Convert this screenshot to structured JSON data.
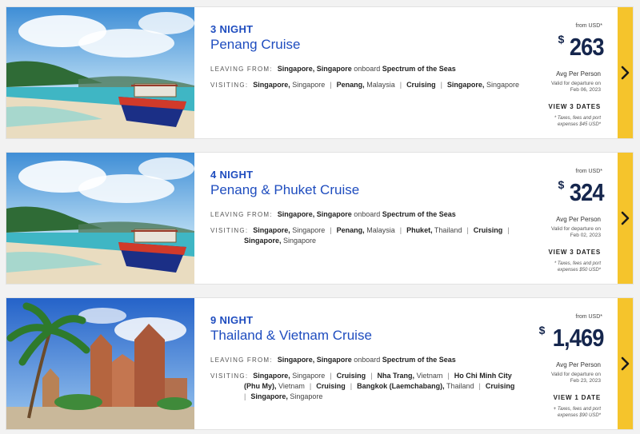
{
  "cruises": [
    {
      "nights": "3 NIGHT",
      "name": "Penang Cruise",
      "leaving_label": "LEAVING FROM:",
      "leaving_port": "Singapore, Singapore",
      "onboard_text": "onboard",
      "ship": "Spectrum of the Seas",
      "visiting_label": "VISITING:",
      "stops": [
        {
          "bold": "Singapore,",
          "rest": "Singapore"
        },
        {
          "bold": "Penang,",
          "rest": "Malaysia"
        },
        {
          "bold": "Cruising",
          "rest": ""
        },
        {
          "bold": "Singapore,",
          "rest": "Singapore"
        }
      ],
      "from_text": "from USD*",
      "currency": "$",
      "price": "263",
      "avg_text": "Avg Per Person",
      "valid_line1": "Valid for departure on",
      "valid_line2": "Feb 06, 2023",
      "dates_link": "VIEW 3 DATES",
      "taxes_line1": "* Taxes, fees and port",
      "taxes_line2": "expenses $45 USD*",
      "image": "beach-boat"
    },
    {
      "nights": "4 NIGHT",
      "name": "Penang & Phuket Cruise",
      "leaving_label": "LEAVING FROM:",
      "leaving_port": "Singapore, Singapore",
      "onboard_text": "onboard",
      "ship": "Spectrum of the Seas",
      "visiting_label": "VISITING:",
      "stops_line1": [
        {
          "bold": "Singapore,",
          "rest": "Singapore"
        },
        {
          "bold": "Penang,",
          "rest": "Malaysia"
        },
        {
          "bold": "Phuket,",
          "rest": "Thailand"
        },
        {
          "bold": "Cruising",
          "rest": ""
        }
      ],
      "stops_line2": [
        {
          "bold": "Singapore,",
          "rest": "Singapore"
        }
      ],
      "from_text": "from USD*",
      "currency": "$",
      "price": "324",
      "avg_text": "Avg Per Person",
      "valid_line1": "Valid for departure on",
      "valid_line2": "Feb 02, 2023",
      "dates_link": "VIEW 3 DATES",
      "taxes_line1": "* Taxes, fees and port",
      "taxes_line2": "expenses $50 USD*",
      "image": "beach-boat"
    },
    {
      "nights": "9 NIGHT",
      "name": "Thailand & Vietnam Cruise",
      "leaving_label": "LEAVING FROM:",
      "leaving_port": "Singapore, Singapore",
      "onboard_text": "onboard",
      "ship": "Spectrum of the Seas",
      "visiting_label": "VISITING:",
      "s1": {
        "bold": "Singapore,",
        "rest": "Singapore"
      },
      "s2": {
        "bold": "Cruising",
        "rest": ""
      },
      "s3": {
        "bold": "Nha Trang,",
        "rest": "Vietnam"
      },
      "s4": {
        "bold": "Ho Chi Minh City",
        "rest": ""
      },
      "s4b": {
        "bold": "(Phu My),",
        "rest": "Vietnam"
      },
      "s5": {
        "bold": "Cruising",
        "rest": ""
      },
      "s6": {
        "bold": "Bangkok (Laemchabang),",
        "rest": "Thailand"
      },
      "s7": {
        "bold": "Cruising",
        "rest": ""
      },
      "s8": {
        "bold": "Singapore,",
        "rest": "Singapore"
      },
      "from_text": "from USD*",
      "currency": "$",
      "price": "1,469",
      "avg_text": "Avg Per Person",
      "valid_line1": "Valid for departure on",
      "valid_line2": "Feb 23, 2023",
      "dates_link": "VIEW 1 DATE",
      "taxes_line1": "+ Taxes, fees and port",
      "taxes_line2": "expenses $90 USD*",
      "image": "temple-palm"
    }
  ],
  "colors": {
    "accent": "#1f4dbf",
    "price": "#15264d",
    "arrow_bar": "#f5c42c"
  },
  "icons": {
    "next": "chevron-right-icon"
  }
}
